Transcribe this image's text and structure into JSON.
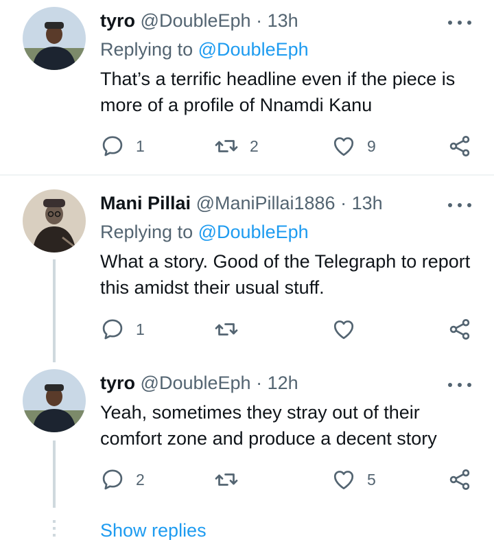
{
  "tweets": [
    {
      "name": "tyro",
      "handle": "@DoubleEph",
      "separator": "·",
      "time": "13h",
      "replying_label": "Replying to",
      "replying_handle": "@DoubleEph",
      "text": "That’s a terrific headline even if the piece is more of a profile of Nnamdi Kanu",
      "replies": "1",
      "retweets": "2",
      "likes": "9"
    },
    {
      "name": "Mani Pillai",
      "handle": "@ManiPillai1886",
      "separator": "·",
      "time": "13h",
      "replying_label": "Replying to",
      "replying_handle": "@DoubleEph",
      "text": "What a story. Good of the Telegraph to report this amidst their usual stuff.",
      "replies": "1",
      "retweets": "",
      "likes": ""
    },
    {
      "name": "tyro",
      "handle": "@DoubleEph",
      "separator": "·",
      "time": "12h",
      "text": "Yeah, sometimes they stray out of their comfort zone and produce a decent story",
      "replies": "2",
      "retweets": "",
      "likes": "5"
    }
  ],
  "show_replies": "Show replies",
  "icons": [
    "reply-icon",
    "retweet-icon",
    "like-icon",
    "share-icon",
    "more-icon"
  ],
  "colors": {
    "link": "#1d9bf0",
    "secondary": "#536471",
    "text": "#0f1419",
    "thread_line": "#cfd9de"
  }
}
